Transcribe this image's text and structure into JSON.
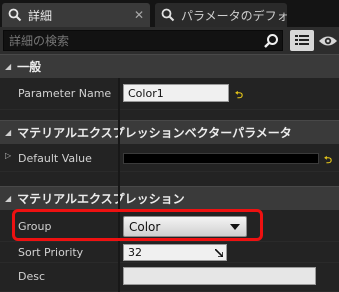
{
  "tabs": [
    {
      "label": "詳細",
      "active": true
    },
    {
      "label": "パラメータのデフォル",
      "active": false
    }
  ],
  "close_glyph": "✕",
  "search": {
    "placeholder": "詳細の検索",
    "value": ""
  },
  "categories": {
    "general": {
      "label": "一般",
      "expanded": true
    },
    "vector_param": {
      "label": "マテリアルエクスプレッションベクターパラメータ",
      "expanded": true
    },
    "expression": {
      "label": "マテリアルエクスプレッション",
      "expanded": true
    }
  },
  "properties": {
    "parameter_name": {
      "label": "Parameter Name",
      "value": "Color1"
    },
    "default_value": {
      "label": "Default Value",
      "value_color": "#000000"
    },
    "group": {
      "label": "Group",
      "value": "Color"
    },
    "sort_priority": {
      "label": "Sort Priority",
      "value": "32"
    },
    "desc": {
      "label": "Desc",
      "value": ""
    }
  },
  "reset_glyph": "⮌",
  "colors": {
    "highlight": "#ee1111",
    "reset_arrow": "#e6c619"
  },
  "icons": [
    "details-icon",
    "magnifier-icon",
    "close-icon",
    "search-icon",
    "view-options-icon",
    "eye-icon"
  ]
}
